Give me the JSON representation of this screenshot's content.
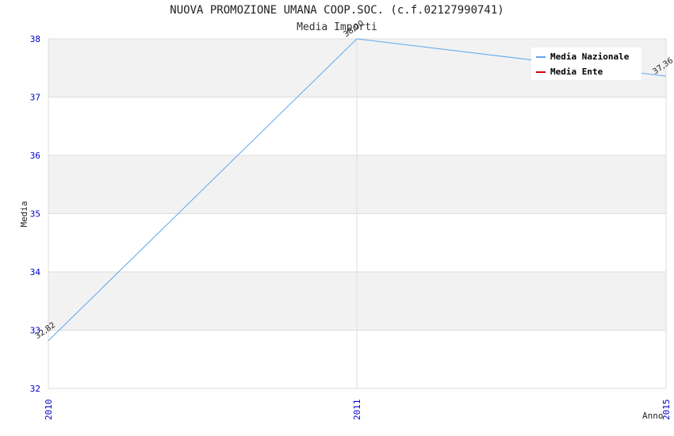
{
  "chart_data": {
    "type": "line",
    "title": "NUOVA PROMOZIONE UMANA COOP.SOC. (c.f.02127990741)",
    "subtitle": "Media Importi",
    "xlabel": "Anno",
    "ylabel": "Media",
    "x": [
      "2010",
      "2011",
      "2015"
    ],
    "ylim": [
      32,
      38
    ],
    "yticks": [
      "32",
      "33",
      "34",
      "35",
      "36",
      "37",
      "38"
    ],
    "grid": true,
    "legend_position": "top-right",
    "series": [
      {
        "name": "Media Nazionale",
        "color": "#5ea8f0",
        "values": [
          32.82,
          38.0,
          37.36
        ],
        "labels": [
          "32,82",
          "38,00",
          "37,36"
        ]
      },
      {
        "name": "Media Ente",
        "color": "#dd0000",
        "values": [],
        "labels": []
      }
    ]
  }
}
